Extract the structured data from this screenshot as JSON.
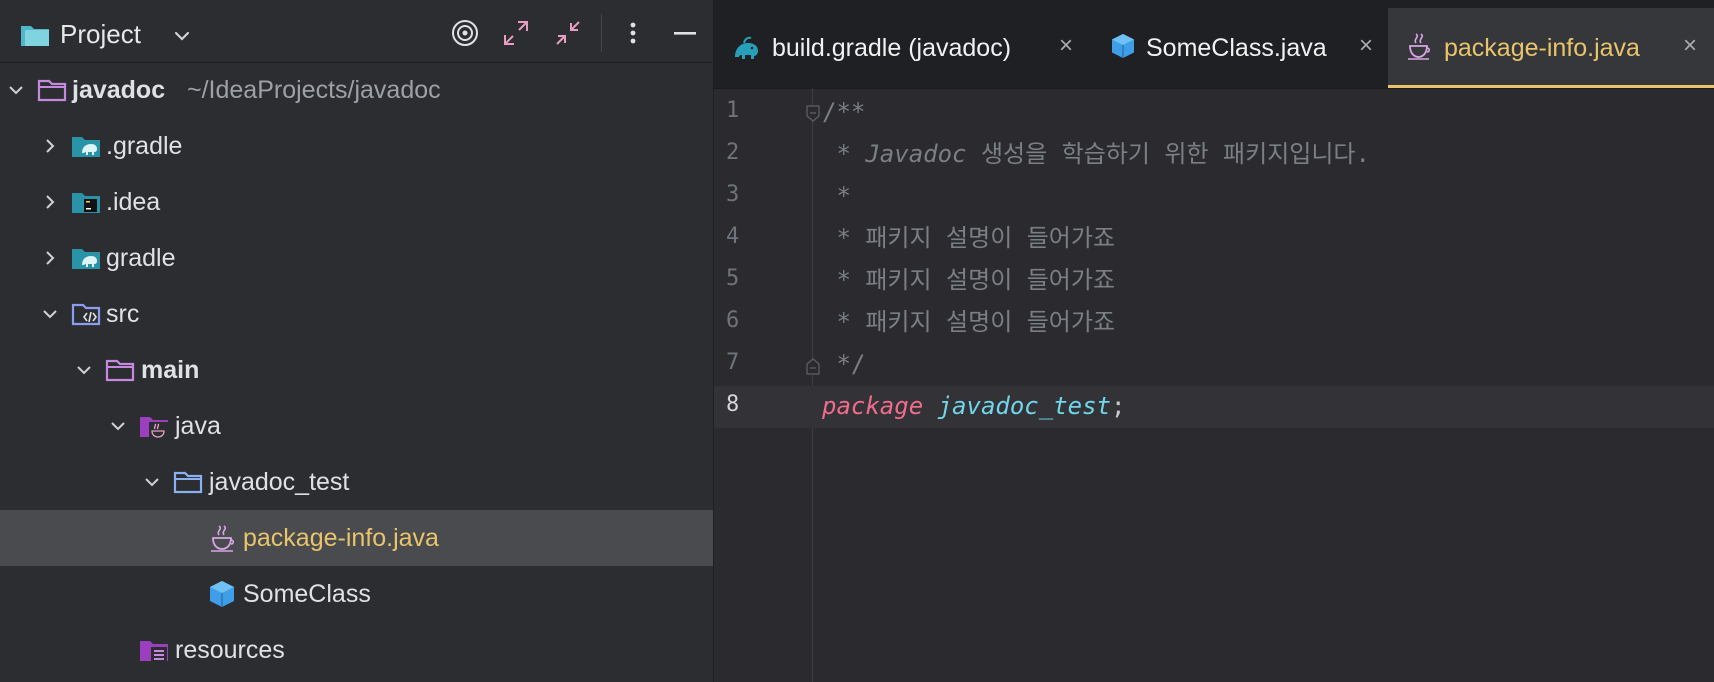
{
  "project_panel": {
    "title": "Project",
    "toolbar": [
      "locate-icon",
      "expand-all-icon",
      "collapse-all-icon",
      "more-icon",
      "hide-icon"
    ],
    "tree": [
      {
        "label": "javadoc",
        "hint": "~/IdeaProjects/javadoc",
        "icon": "folder-module-icon",
        "state": "expanded",
        "bold": true
      },
      {
        "label": ".gradle",
        "icon": "gradle-folder-icon",
        "state": "collapsed"
      },
      {
        "label": ".idea",
        "icon": "idea-folder-icon",
        "state": "collapsed"
      },
      {
        "label": "gradle",
        "icon": "gradle-folder-icon",
        "state": "collapsed"
      },
      {
        "label": "src",
        "icon": "source-folder-icon",
        "state": "expanded"
      },
      {
        "label": "main",
        "icon": "folder-icon",
        "state": "expanded",
        "bold": true
      },
      {
        "label": "java",
        "icon": "java-source-root-icon",
        "state": "expanded"
      },
      {
        "label": "javadoc_test",
        "icon": "package-folder-icon",
        "state": "expanded"
      },
      {
        "label": "package-info.java",
        "icon": "java-file-icon",
        "selected": true
      },
      {
        "label": "SomeClass",
        "icon": "class-icon"
      },
      {
        "label": "resources",
        "icon": "resources-folder-icon"
      }
    ]
  },
  "editor": {
    "tabs": [
      {
        "label": "build.gradle (javadoc)",
        "icon": "gradle-icon",
        "active": false
      },
      {
        "label": "SomeClass.java",
        "icon": "class-icon",
        "active": false
      },
      {
        "label": "package-info.java",
        "icon": "java-file-icon",
        "active": true
      }
    ],
    "lines": [
      {
        "num": "1",
        "text": "/**"
      },
      {
        "num": "2",
        "text": " * Javadoc 생성을 학습하기 위한 패키지입니다."
      },
      {
        "num": "3",
        "text": " *"
      },
      {
        "num": "4",
        "text": " * 패키지 설명이 들어가죠"
      },
      {
        "num": "5",
        "text": " * 패키지 설명이 들어가죠"
      },
      {
        "num": "6",
        "text": " * 패키지 설명이 들어가죠"
      },
      {
        "num": "7",
        "text": " */"
      },
      {
        "num": "8",
        "keyword": "package",
        "package_name": "javadoc_test",
        "punct": ";",
        "current": true
      }
    ],
    "line2_parts": {
      "prefix": " * ",
      "italic": "Javadoc",
      "rest": " 생성을 학습하기 위한 패키지입니다."
    }
  },
  "colors": {
    "accent_yellow": "#e8c46b",
    "keyword": "#f06b8c",
    "package_name": "#70d6ea",
    "comment": "#7a7e85"
  }
}
